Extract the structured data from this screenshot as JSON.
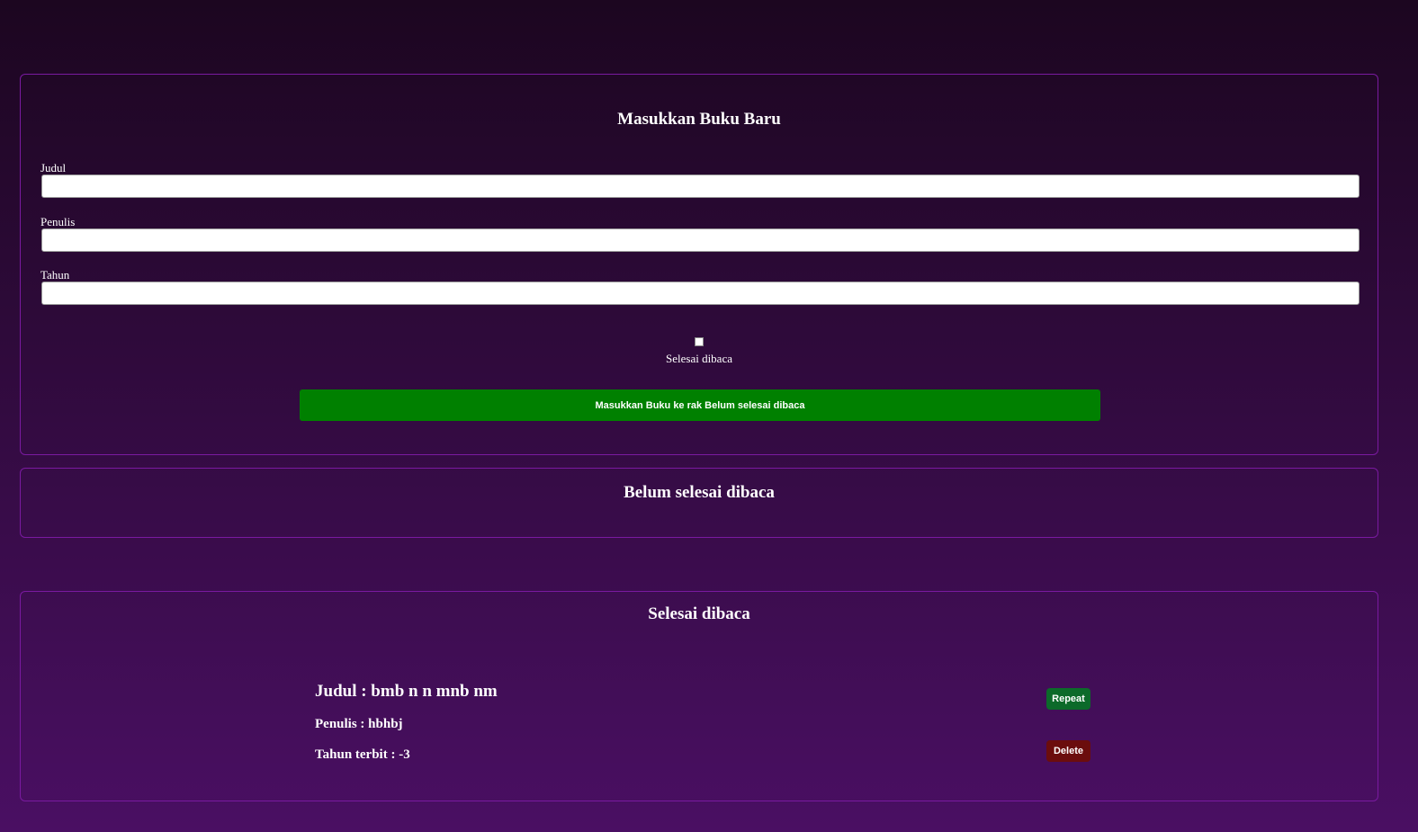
{
  "input_section": {
    "title": "Masukkan Buku Baru",
    "fields": {
      "judul": {
        "label": "Judul",
        "value": "",
        "placeholder": ""
      },
      "penulis": {
        "label": "Penulis",
        "value": "",
        "placeholder": ""
      },
      "tahun": {
        "label": "Tahun",
        "value": "",
        "placeholder": ""
      }
    },
    "checkbox_label": "Selesai dibaca",
    "checkbox_checked": false,
    "submit_label": "Masukkan Buku ke rak Belum selesai dibaca"
  },
  "incomplete_section": {
    "title": "Belum selesai dibaca",
    "books": []
  },
  "complete_section": {
    "title": "Selesai dibaca",
    "books": [
      {
        "title": "Judul : bmb n n mnb nm",
        "author": "Penulis : hbhbj",
        "year": "Tahun terbit : -3",
        "repeat_label": "Repeat",
        "delete_label": "Delete"
      }
    ]
  },
  "colors": {
    "submit_button": "#008000",
    "repeat_button": "#0c6a2a",
    "delete_button": "#6b0d0d",
    "panel_border": "#7a1aa0"
  }
}
